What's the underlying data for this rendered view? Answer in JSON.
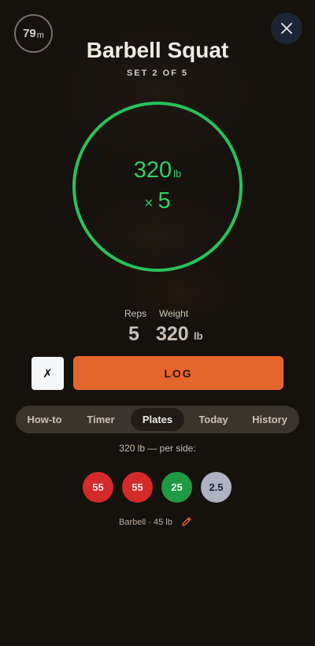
{
  "header": {
    "rest_timer": {
      "value": "79",
      "unit": "m"
    },
    "title": "Barbell Squat",
    "subtitle": "SET 2 OF 5",
    "close_icon": "close-icon"
  },
  "ring": {
    "weight": "320",
    "unit": "lb",
    "times": "×",
    "reps": "5",
    "color": "#27c25c"
  },
  "fields": {
    "reps_label": "Reps",
    "weight_label": "Weight",
    "reps_value": "5",
    "weight_value": "320",
    "weight_unit": "lb"
  },
  "actions": {
    "cancel_label": "✗",
    "log_label": "LOG",
    "log_color": "#e5662c"
  },
  "tabs": [
    {
      "label": "How-to",
      "active": false
    },
    {
      "label": "Timer",
      "active": false
    },
    {
      "label": "Plates",
      "active": true
    },
    {
      "label": "Today",
      "active": false
    },
    {
      "label": "History",
      "active": false
    }
  ],
  "plates": {
    "per_side_text": "320 lb — per side:",
    "items": [
      {
        "label": "55",
        "color": "#d42a2a"
      },
      {
        "label": "55",
        "color": "#d42a2a"
      },
      {
        "label": "25",
        "color": "#1f9a43"
      },
      {
        "label": "2.5",
        "color": "#aeb2c2"
      }
    ],
    "barbell_text": "Barbell · 45 lb",
    "edit_icon": "pencil-icon"
  }
}
